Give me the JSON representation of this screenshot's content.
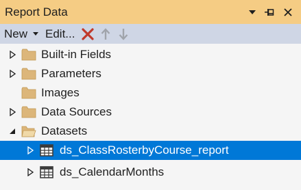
{
  "panel": {
    "title": "Report Data",
    "title_icons": [
      "dropdown-arrow-icon",
      "pin-icon",
      "close-icon"
    ]
  },
  "toolbar": {
    "new_label": "New",
    "edit_label": "Edit...",
    "icons": [
      "delete-icon",
      "move-up-icon",
      "move-down-icon"
    ]
  },
  "tree": {
    "nodes": [
      {
        "label": "Built-in Fields",
        "expander": "collapsed",
        "icon": "folder-icon"
      },
      {
        "label": "Parameters",
        "expander": "collapsed",
        "icon": "folder-icon"
      },
      {
        "label": "Images",
        "expander": "none",
        "icon": "folder-icon"
      },
      {
        "label": "Data Sources",
        "expander": "collapsed",
        "icon": "folder-icon"
      },
      {
        "label": "Datasets",
        "expander": "expanded",
        "icon": "open-folder-icon"
      },
      {
        "label": "ds_ClassRosterbyCourse_report",
        "expander": "collapsed",
        "icon": "dataset-table-icon",
        "selected": true
      },
      {
        "label": "ds_CalendarMonths",
        "expander": "collapsed",
        "icon": "dataset-table-icon"
      }
    ]
  },
  "colors": {
    "title_bar": "#f5cc84",
    "toolbar": "#cfd6e5",
    "selection": "#0078d7",
    "delete": "#c0392b",
    "folder": "#dcb67a"
  }
}
